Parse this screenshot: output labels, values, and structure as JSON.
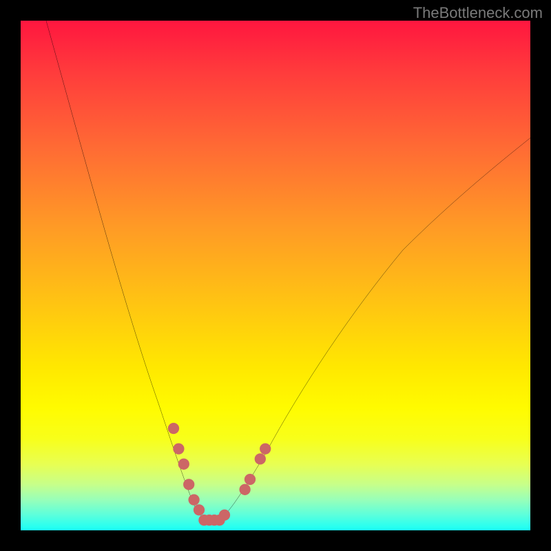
{
  "watermark": "TheBottleneck.com",
  "chart_data": {
    "type": "line",
    "title": "",
    "xlabel": "",
    "ylabel": "",
    "xlim": [
      0,
      100
    ],
    "ylim": [
      0,
      100
    ],
    "grid": false,
    "legend": false,
    "series": [
      {
        "name": "bottleneck-curve",
        "color": "#000000",
        "x": [
          5,
          8,
          12,
          16,
          20,
          24,
          27,
          30,
          32,
          34,
          35,
          36,
          37,
          38,
          40,
          42,
          44,
          47,
          52,
          58,
          65,
          72,
          80,
          88,
          95,
          100
        ],
        "y": [
          100,
          90,
          78,
          65,
          52,
          40,
          30,
          20,
          13,
          7,
          4,
          2,
          2,
          2,
          3,
          5,
          8,
          13,
          22,
          32,
          42,
          51,
          60,
          67,
          73,
          77
        ]
      }
    ],
    "annotations": [
      {
        "name": "highlight-dots",
        "type": "marker",
        "color": "#cc6666",
        "points": [
          {
            "x": 30,
            "y": 20
          },
          {
            "x": 31,
            "y": 16
          },
          {
            "x": 32,
            "y": 13
          },
          {
            "x": 33,
            "y": 9
          },
          {
            "x": 34,
            "y": 6
          },
          {
            "x": 35,
            "y": 4
          },
          {
            "x": 36,
            "y": 2
          },
          {
            "x": 37,
            "y": 2
          },
          {
            "x": 38,
            "y": 2
          },
          {
            "x": 39,
            "y": 2
          },
          {
            "x": 40,
            "y": 3
          },
          {
            "x": 44,
            "y": 8
          },
          {
            "x": 45,
            "y": 10
          },
          {
            "x": 47,
            "y": 14
          },
          {
            "x": 48,
            "y": 16
          }
        ]
      }
    ]
  }
}
